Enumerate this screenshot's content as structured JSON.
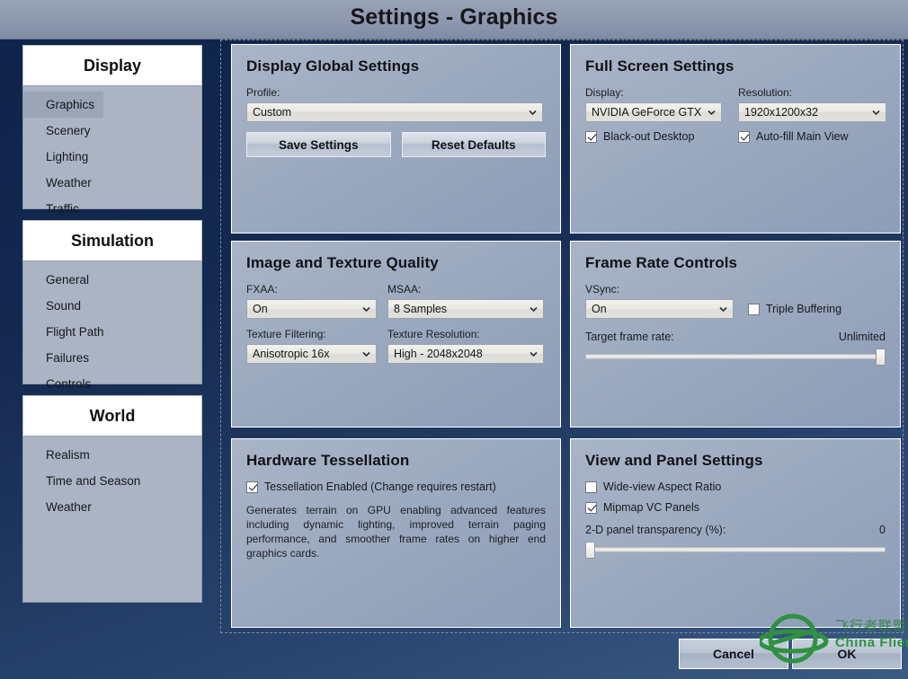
{
  "window": {
    "title": "Settings - Graphics"
  },
  "sidebar": {
    "groups": [
      {
        "header": "Display",
        "items": [
          {
            "label": "Graphics",
            "active": true
          },
          {
            "label": "Scenery",
            "active": false
          },
          {
            "label": "Lighting",
            "active": false
          },
          {
            "label": "Weather",
            "active": false
          },
          {
            "label": "Traffic",
            "active": false
          }
        ]
      },
      {
        "header": "Simulation",
        "items": [
          {
            "label": "General",
            "active": false
          },
          {
            "label": "Sound",
            "active": false
          },
          {
            "label": "Flight Path",
            "active": false
          },
          {
            "label": "Failures",
            "active": false
          },
          {
            "label": "Controls",
            "active": false
          }
        ]
      },
      {
        "header": "World",
        "items": [
          {
            "label": "Realism",
            "active": false
          },
          {
            "label": "Time and Season",
            "active": false
          },
          {
            "label": "Weather",
            "active": false
          }
        ]
      }
    ]
  },
  "panels": {
    "display_global": {
      "title": "Display Global Settings",
      "profile_label": "Profile:",
      "profile_value": "Custom",
      "save_label": "Save Settings",
      "reset_label": "Reset Defaults"
    },
    "full_screen": {
      "title": "Full Screen Settings",
      "display_label": "Display:",
      "display_value": "NVIDIA GeForce GTX",
      "resolution_label": "Resolution:",
      "resolution_value": "1920x1200x32",
      "blackout_label": "Black-out Desktop",
      "blackout_checked": true,
      "autofill_label": "Auto-fill Main View",
      "autofill_checked": true
    },
    "image_texture": {
      "title": "Image and Texture Quality",
      "fxaa_label": "FXAA:",
      "fxaa_value": "On",
      "msaa_label": "MSAA:",
      "msaa_value": "8 Samples",
      "filtering_label": "Texture Filtering:",
      "filtering_value": "Anisotropic 16x",
      "resolution_label": "Texture Resolution:",
      "resolution_value": "High - 2048x2048"
    },
    "frame_rate": {
      "title": "Frame Rate Controls",
      "vsync_label": "VSync:",
      "vsync_value": "On",
      "triple_buffering_label": "Triple Buffering",
      "triple_buffering_checked": false,
      "target_label": "Target frame rate:",
      "target_value": "Unlimited",
      "target_slider_percent": 100
    },
    "tessellation": {
      "title": "Hardware Tessellation",
      "enabled_label": "Tessellation Enabled (Change requires restart)",
      "enabled_checked": true,
      "description": "Generates terrain on GPU enabling advanced features including dynamic lighting, improved terrain paging performance, and smoother frame rates on higher end graphics cards."
    },
    "view_panel": {
      "title": "View and Panel Settings",
      "wideview_label": "Wide-view Aspect Ratio",
      "wideview_checked": false,
      "mipmap_label": "Mipmap VC Panels",
      "mipmap_checked": true,
      "transparency_label": "2-D panel transparency (%):",
      "transparency_value": "0",
      "transparency_slider_percent": 0
    }
  },
  "footer": {
    "cancel_label": "Cancel",
    "ok_label": "OK"
  },
  "watermark": {
    "chinese": "飞行者联盟",
    "english": "China Flier",
    "color": "#2f9141"
  },
  "colors": {
    "window_background": "#14294f",
    "titlebar": "#8d98ae",
    "panel": "#9dabc0",
    "sidebar_list": "#aab4c4",
    "sidebar_header": "#ffffff",
    "active_item": "#9aa5b8"
  }
}
